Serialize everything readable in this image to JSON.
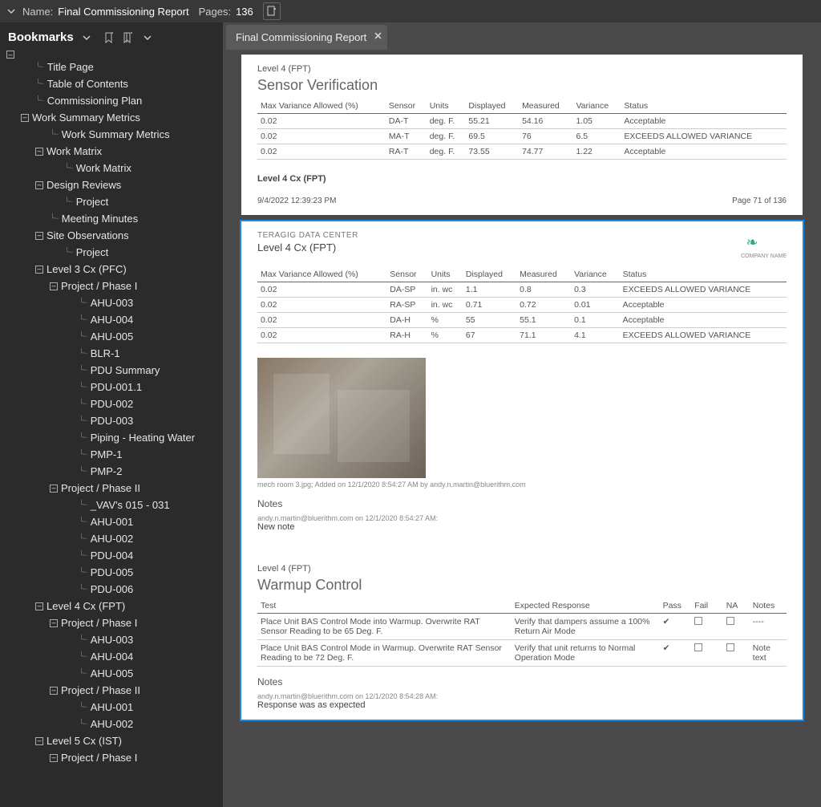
{
  "topbar": {
    "name_label": "Name:",
    "name_value": "Final Commissioning Report",
    "pages_label": "Pages:",
    "pages_value": "136"
  },
  "sidebar": {
    "title": "Bookmarks",
    "items": [
      {
        "d": 2,
        "t": "leaf",
        "label": "Title Page"
      },
      {
        "d": 2,
        "t": "leaf",
        "label": "Table of Contents"
      },
      {
        "d": 2,
        "t": "leaf",
        "label": "Commissioning Plan"
      },
      {
        "d": 1,
        "t": "open",
        "label": "Work Summary Metrics"
      },
      {
        "d": 3,
        "t": "leaf",
        "label": "Work Summary Metrics"
      },
      {
        "d": 2,
        "t": "open",
        "label": "Work Matrix"
      },
      {
        "d": 4,
        "t": "leaf",
        "label": "Work Matrix"
      },
      {
        "d": 2,
        "t": "open",
        "label": "Design Reviews"
      },
      {
        "d": 4,
        "t": "leaf",
        "label": "Project"
      },
      {
        "d": 3,
        "t": "leaf",
        "label": "Meeting Minutes"
      },
      {
        "d": 2,
        "t": "open",
        "label": "Site Observations"
      },
      {
        "d": 4,
        "t": "leaf",
        "label": "Project"
      },
      {
        "d": 2,
        "t": "open",
        "label": "Level 3 Cx (PFC)"
      },
      {
        "d": 3,
        "t": "open",
        "label": "Project / Phase I"
      },
      {
        "d": 5,
        "t": "leaf",
        "label": "AHU-003"
      },
      {
        "d": 5,
        "t": "leaf",
        "label": "AHU-004"
      },
      {
        "d": 5,
        "t": "leaf",
        "label": "AHU-005"
      },
      {
        "d": 5,
        "t": "leaf",
        "label": "BLR-1"
      },
      {
        "d": 5,
        "t": "leaf",
        "label": "PDU Summary"
      },
      {
        "d": 5,
        "t": "leaf",
        "label": "PDU-001.1"
      },
      {
        "d": 5,
        "t": "leaf",
        "label": "PDU-002"
      },
      {
        "d": 5,
        "t": "leaf",
        "label": "PDU-003"
      },
      {
        "d": 5,
        "t": "leaf",
        "label": "Piping - Heating Water"
      },
      {
        "d": 5,
        "t": "leaf",
        "label": "PMP-1"
      },
      {
        "d": 5,
        "t": "leaf",
        "label": "PMP-2"
      },
      {
        "d": 3,
        "t": "open",
        "label": "Project / Phase II"
      },
      {
        "d": 5,
        "t": "leaf",
        "label": "_VAV's 015 - 031"
      },
      {
        "d": 5,
        "t": "leaf",
        "label": "AHU-001"
      },
      {
        "d": 5,
        "t": "leaf",
        "label": "AHU-002"
      },
      {
        "d": 5,
        "t": "leaf",
        "label": "PDU-004"
      },
      {
        "d": 5,
        "t": "leaf",
        "label": "PDU-005"
      },
      {
        "d": 5,
        "t": "leaf",
        "label": "PDU-006"
      },
      {
        "d": 2,
        "t": "open",
        "label": "Level 4 Cx (FPT)"
      },
      {
        "d": 3,
        "t": "open",
        "label": "Project / Phase I"
      },
      {
        "d": 5,
        "t": "leaf",
        "label": "AHU-003"
      },
      {
        "d": 5,
        "t": "leaf",
        "label": "AHU-004"
      },
      {
        "d": 5,
        "t": "leaf",
        "label": "AHU-005"
      },
      {
        "d": 3,
        "t": "open",
        "label": "Project / Phase II"
      },
      {
        "d": 5,
        "t": "leaf",
        "label": "AHU-001"
      },
      {
        "d": 5,
        "t": "leaf",
        "label": "AHU-002"
      },
      {
        "d": 2,
        "t": "open",
        "label": "Level 5 Cx (IST)"
      },
      {
        "d": 3,
        "t": "open",
        "label": "Project / Phase I"
      }
    ]
  },
  "tab": {
    "label": "Final Commissioning Report"
  },
  "page1": {
    "level": "Level 4 (FPT)",
    "title": "Sensor Verification",
    "cols": [
      "Max Variance Allowed (%)",
      "Sensor",
      "Units",
      "Displayed",
      "Measured",
      "Variance",
      "Status"
    ],
    "rows": [
      [
        "0.02",
        "DA-T",
        "deg. F.",
        "55.21",
        "54.16",
        "1.05",
        "Acceptable"
      ],
      [
        "0.02",
        "MA-T",
        "deg. F.",
        "69.5",
        "76",
        "6.5",
        "EXCEEDS ALLOWED VARIANCE"
      ],
      [
        "0.02",
        "RA-T",
        "deg. F.",
        "73.55",
        "74.77",
        "1.22",
        "Acceptable"
      ]
    ],
    "foot_level": "Level 4 Cx (FPT)",
    "timestamp": "9/4/2022 12:39:23 PM",
    "pager": "Page 71 of 136"
  },
  "page2": {
    "dc": "TERAGIG DATA CENTER",
    "level": "Level 4 Cx (FPT)",
    "logo_cap": "COMPANY NAME",
    "cols": [
      "Max Variance Allowed (%)",
      "Sensor",
      "Units",
      "Displayed",
      "Measured",
      "Variance",
      "Status"
    ],
    "rows": [
      [
        "0.02",
        "DA-SP",
        "in. wc",
        "1.1",
        "0.8",
        "0.3",
        "EXCEEDS ALLOWED VARIANCE"
      ],
      [
        "0.02",
        "RA-SP",
        "in. wc",
        "0.71",
        "0.72",
        "0.01",
        "Acceptable"
      ],
      [
        "0.02",
        "DA-H",
        "%",
        "55",
        "55.1",
        "0.1",
        "Acceptable"
      ],
      [
        "0.02",
        "RA-H",
        "%",
        "67",
        "71.1",
        "4.1",
        "EXCEEDS ALLOWED VARIANCE"
      ]
    ],
    "photo_cap": "mech room 3.jpg; Added on 12/1/2020 8:54:27 AM by andy.n.martin@bluerithm.com",
    "notes_h": "Notes",
    "notes_meta": "andy.n.martin@bluerithm.com on 12/1/2020 8:54:27 AM:",
    "notes_body": "New note",
    "section2_level": "Level 4 (FPT)",
    "section2_title": "Warmup Control",
    "wc_cols": [
      "Test",
      "Expected Response",
      "Pass",
      "Fail",
      "NA",
      "Notes"
    ],
    "wc_rows": [
      {
        "test": "Place Unit BAS Control Mode into Warmup. Overwrite RAT Sensor Reading to be 65 Deg. F.",
        "exp": "Verify that dampers assume a 100% Return Air Mode",
        "pass": "✔",
        "fail": "",
        "na": "",
        "notes": "----"
      },
      {
        "test": "Place Unit BAS Control Mode in Warmup. Overwrite RAT Sensor Reading to be 72 Deg. F.",
        "exp": "Verify that unit returns to Normal Operation Mode",
        "pass": "✔",
        "fail": "",
        "na": "",
        "notes": "Note text"
      }
    ],
    "notes2_h": "Notes",
    "notes2_meta": "andy.n.martin@bluerithm.com on 12/1/2020 8:54:28 AM:",
    "notes2_body": "Response was as expected"
  }
}
